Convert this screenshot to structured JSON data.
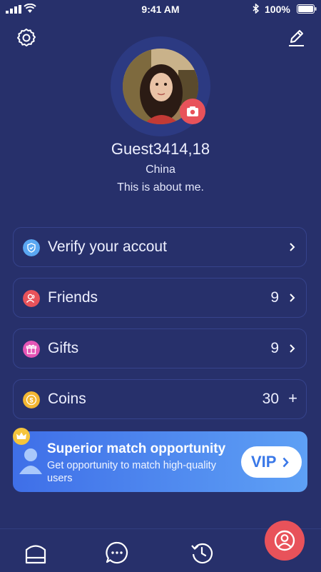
{
  "status_bar": {
    "time": "9:41 AM",
    "battery": "100%"
  },
  "profile": {
    "name": "Guest3414,18",
    "location": "China",
    "about": "This is about me."
  },
  "menu": {
    "verify": {
      "label": "Verify your accout",
      "icon": "shield-icon",
      "color": "#5aa7f2"
    },
    "friends": {
      "label": "Friends",
      "value": "9",
      "icon": "friends-icon",
      "color": "#e8525a"
    },
    "gifts": {
      "label": "Gifts",
      "value": "9",
      "icon": "gift-icon",
      "color": "#e455b5"
    },
    "coins": {
      "label": "Coins",
      "value": "30",
      "action": "+",
      "icon": "coin-icon",
      "color": "#f2b632"
    }
  },
  "promo": {
    "title": "Superior match opportunity",
    "description": "Get opportunity to match high-quality users",
    "button": "VIP"
  },
  "colors": {
    "background": "#27306b",
    "accent_red": "#e8525a",
    "vip_blue": "#3a78e8"
  }
}
